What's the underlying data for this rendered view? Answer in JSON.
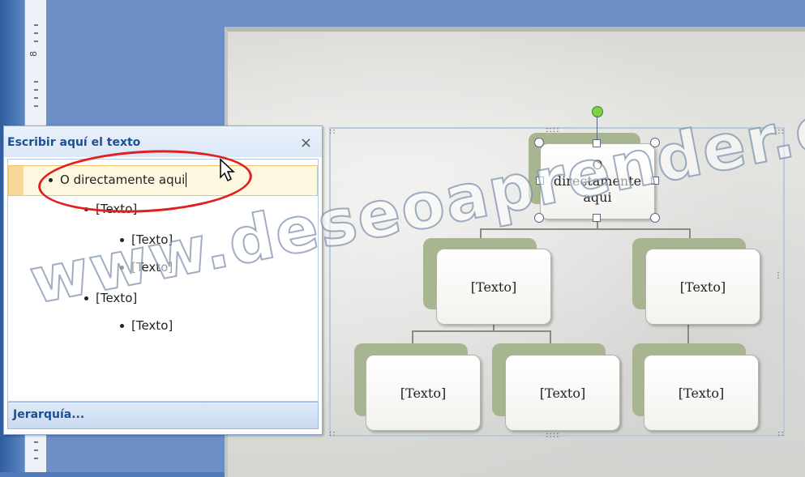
{
  "ruler": {
    "number": "8"
  },
  "text_pane": {
    "title": "Escribir aquí el texto",
    "close": "×",
    "items": [
      {
        "text": "O directamente aqui",
        "level": 1
      },
      {
        "text": "[Texto]",
        "level": 2
      },
      {
        "text": "[Texto]",
        "level": 3
      },
      {
        "text": "[Texto]",
        "level": 3
      },
      {
        "text": "[Texto]",
        "level": 2
      },
      {
        "text": "[Texto]",
        "level": 3
      }
    ],
    "footer": "Jerarquía..."
  },
  "smartart": {
    "top_box": "O directamente aqui",
    "mid_left": "[Texto]",
    "mid_right": "[Texto]",
    "bottom_1": "[Texto]",
    "bottom_2": "[Texto]",
    "bottom_3": "[Texto]"
  },
  "watermark": "www.deseoaprender.com",
  "colors": {
    "annotation": "#e02020",
    "box_back": "#a7b590",
    "pane_title": "#1d4f91"
  }
}
